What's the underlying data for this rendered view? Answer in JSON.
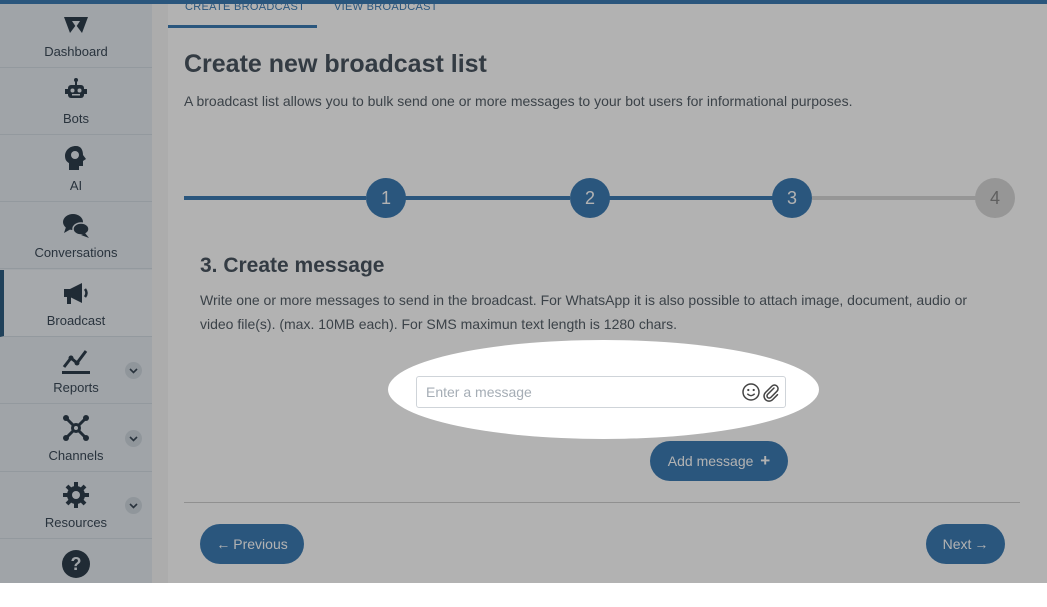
{
  "sidebar": {
    "items": [
      {
        "label": "Dashboard",
        "icon": "dashboard-icon"
      },
      {
        "label": "Bots",
        "icon": "robot-icon"
      },
      {
        "label": "AI",
        "icon": "head-icon"
      },
      {
        "label": "Conversations",
        "icon": "chat-bubbles-icon"
      },
      {
        "label": "Broadcast",
        "icon": "megaphone-icon",
        "active": true
      },
      {
        "label": "Reports",
        "icon": "line-chart-icon",
        "expandable": true
      },
      {
        "label": "Channels",
        "icon": "network-icon",
        "expandable": true
      },
      {
        "label": "Resources",
        "icon": "gear-icon",
        "expandable": true
      },
      {
        "label": "",
        "icon": "help-icon"
      }
    ]
  },
  "tabs": {
    "create": "CREATE BROADCAST",
    "view": "VIEW BROADCAST"
  },
  "page": {
    "title": "Create new broadcast list",
    "subtitle": "A broadcast list allows you to bulk send one or more messages to your bot users for informational purposes."
  },
  "stepper": {
    "steps": [
      "1",
      "2",
      "3",
      "4"
    ],
    "current_step": 3
  },
  "section": {
    "title": "3. Create message",
    "description": "Write one or more messages to send in the broadcast. For WhatsApp it is also possible to attach image, document, audio or video file(s). (max. 10MB each). For SMS maximun text length is 1280 chars."
  },
  "message_input": {
    "placeholder": "Enter a message",
    "value": ""
  },
  "buttons": {
    "add_message": "Add message",
    "previous": "Previous",
    "next": "Next"
  },
  "colors": {
    "primary": "#3d7cb4",
    "sidebar_bg": "#e5ebf1",
    "text_dark": "#4a5560",
    "step_inactive": "#d7d7d7"
  }
}
